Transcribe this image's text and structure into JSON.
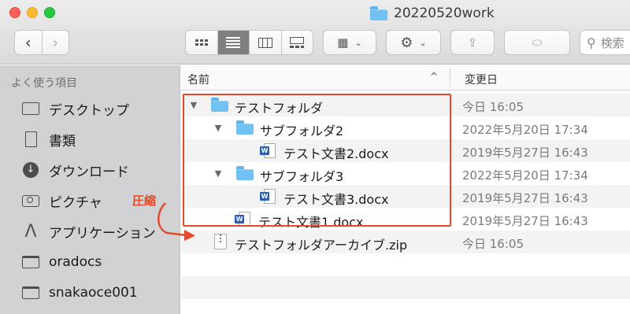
{
  "window": {
    "title": "20220520work"
  },
  "toolbar": {
    "back_glyph": "‹",
    "forward_glyph": "›",
    "arrange_glyph": "▦",
    "action_glyph": "⚙",
    "share_glyph": "⇪",
    "tag_glyph": "⬭",
    "chevron": "⌄",
    "search_placeholder": "検索",
    "active_view": "list"
  },
  "sidebar": {
    "heading": "よく使う項目",
    "items": [
      {
        "label": "デスクトップ",
        "icon": "desktop-icon"
      },
      {
        "label": "書類",
        "icon": "documents-icon"
      },
      {
        "label": "ダウンロード",
        "icon": "downloads-icon"
      },
      {
        "label": "ピクチャ",
        "icon": "camera-icon"
      },
      {
        "label": "アプリケーション",
        "icon": "applications-icon"
      },
      {
        "label": "oradocs",
        "icon": "folder-icon"
      },
      {
        "label": "snakaoce001",
        "icon": "folder-icon"
      }
    ]
  },
  "list": {
    "headers": {
      "name": "名前",
      "modified": "変更日",
      "sort_glyph": "^"
    },
    "rows": [
      {
        "name": "テストフォルダ",
        "date": "今日 16:05",
        "kind": "folder",
        "expanded": true,
        "level": 0
      },
      {
        "name": "サブフォルダ2",
        "date": "2022年5月20日 17:34",
        "kind": "folder",
        "expanded": true,
        "level": 1
      },
      {
        "name": "テスト文書2.docx",
        "date": "2019年5月27日 16:43",
        "kind": "docx",
        "level": 2
      },
      {
        "name": "サブフォルダ3",
        "date": "2022年5月20日 17:34",
        "kind": "folder",
        "expanded": true,
        "level": 1
      },
      {
        "name": "テスト文書3.docx",
        "date": "2019年5月27日 16:43",
        "kind": "docx",
        "level": 2
      },
      {
        "name": "テスト文書1.docx",
        "date": "2019年5月27日 16:43",
        "kind": "docx",
        "level": 1
      },
      {
        "name": "テストフォルダアーカイブ.zip",
        "date": "今日 16:05",
        "kind": "zip",
        "level": 0
      }
    ]
  },
  "annotation": {
    "label": "圧縮",
    "color": "#e24a2c"
  },
  "colors": {
    "sidebar_bg": "#d2d2d4",
    "folder_blue": "#72c1f4",
    "word_blue": "#2b5fb4"
  }
}
